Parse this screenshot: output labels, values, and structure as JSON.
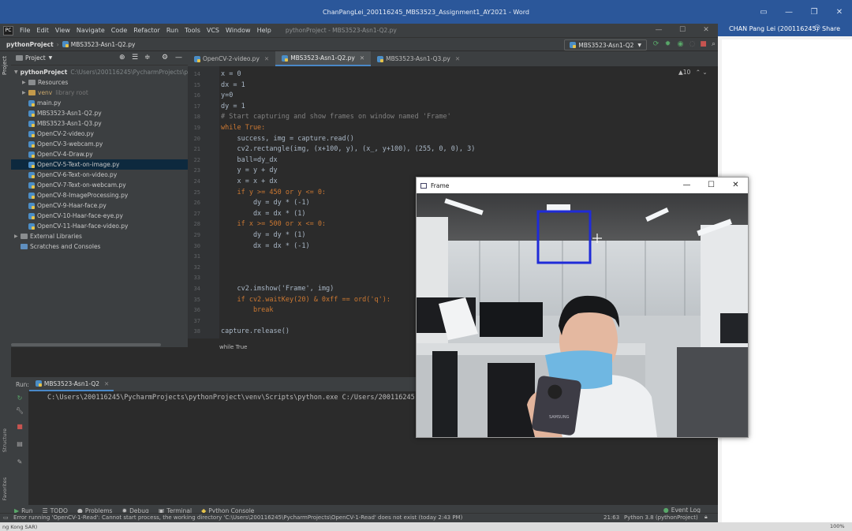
{
  "word": {
    "title": "ChanPangLei_200116245_MBS3523_Assignment1_AY2021 - Word",
    "user": "CHAN Pang Lei (200116245)",
    "share": "Share",
    "status_left": "ng Kong SAR)",
    "zoom": "100%"
  },
  "menu": {
    "items": [
      "File",
      "Edit",
      "View",
      "Navigate",
      "Code",
      "Refactor",
      "Run",
      "Tools",
      "VCS",
      "Window",
      "Help"
    ],
    "title": "pythonProject - MBS3523-Asn1-Q2.py"
  },
  "navbar": {
    "project": "pythonProject",
    "file": "MBS3523-Asn1-Q2.py",
    "run_config": "MBS3523-Asn1-Q2"
  },
  "project_panel": {
    "header": "Project",
    "root_name": "pythonProject",
    "root_path": "C:\\Users\\200116245\\PycharmProjects\\py",
    "items": [
      {
        "label": "Resources",
        "kind": "folder"
      },
      {
        "label": "venv",
        "hint": "library root",
        "kind": "venv"
      },
      {
        "label": "main.py",
        "kind": "py"
      },
      {
        "label": "MBS3523-Asn1-Q2.py",
        "kind": "py"
      },
      {
        "label": "MBS3523-Asn1-Q3.py",
        "kind": "py"
      },
      {
        "label": "OpenCV-2-video.py",
        "kind": "py"
      },
      {
        "label": "OpenCV-3-webcam.py",
        "kind": "py"
      },
      {
        "label": "OpenCV-4-Draw.py",
        "kind": "py"
      },
      {
        "label": "OpenCV-5-Text-on-image.py",
        "kind": "py"
      },
      {
        "label": "OpenCV-6-Text-on-video.py",
        "kind": "py"
      },
      {
        "label": "OpenCV-7-Text-on-webcam.py",
        "kind": "py"
      },
      {
        "label": "OpenCV-8-ImageProcessing.py",
        "kind": "py"
      },
      {
        "label": "OpenCV-9-Haar-face.py",
        "kind": "py"
      },
      {
        "label": "OpenCV-10-Haar-face-eye.py",
        "kind": "py"
      },
      {
        "label": "OpenCV-11-Haar-face-video.py",
        "kind": "py"
      },
      {
        "label": "External Libraries",
        "kind": "lib"
      },
      {
        "label": "Scratches and Consoles",
        "kind": "scratch"
      }
    ]
  },
  "tabs": [
    "OpenCV-2-video.py",
    "MBS3523-Asn1-Q2.py",
    "MBS3523-Asn1-Q3.py"
  ],
  "warnings": "▲10",
  "editor": {
    "line_numbers": [
      "14",
      "15",
      "16",
      "17",
      "18",
      "19",
      "20",
      "21",
      "22",
      "23",
      "24",
      "25",
      "26",
      "27",
      "28",
      "29",
      "30",
      "31",
      "32",
      "33",
      "34",
      "35",
      "36",
      "37",
      "38"
    ],
    "lines": [
      "x = 0",
      "dx = 1",
      "y=0",
      "dy = 1",
      "# Start capturing and show frames on window named 'Frame'",
      "while True:",
      "    success, img = capture.read()",
      "    cv2.rectangle(img, (x+100, y), (x_, y+100), (255, 0, 0), 3)",
      "    ball=dy_dx",
      "    y = y + dy",
      "    x = x + dx",
      "    if y >= 450 or y <= 0:",
      "        dy = dy * (-1)",
      "        dx = dx * (1)",
      "    if x >= 500 or x <= 0:",
      "        dy = dy * (1)",
      "        dx = dx * (-1)",
      "",
      "",
      "",
      "    cv2.imshow('Frame', img)",
      "    if cv2.waitKey(20) & 0xff == ord('q'):",
      "        break",
      "",
      "capture.release()"
    ],
    "breadcrumb": "while True"
  },
  "run_panel": {
    "label": "Run:",
    "tab": "MBS3523-Asn1-Q2",
    "console": "C:\\Users\\200116245\\PycharmProjects\\pythonProject\\venv\\Scripts\\python.exe C:/Users/200116245"
  },
  "bottom_tools": [
    "Run",
    "TODO",
    "Problems",
    "Debug",
    "Terminal",
    "Python Console"
  ],
  "event_log": "Event Log",
  "side_labels": {
    "structure": "Structure",
    "favorites": "Favorites",
    "project": "Project"
  },
  "status": {
    "message": "Error running 'OpenCV-1-Read': Cannot start process, the working directory 'C:\\Users\\200116245\\PycharmProjects\\OpenCV-1-Read' does not exist (today 2:43 PM)",
    "position": "21:63",
    "interpreter": "Python 3.8 (pythonProject)"
  },
  "frame_window": {
    "title": "Frame",
    "rect_color": "#1f2bd8",
    "phone_brand": "SAMSUNG"
  },
  "colors": {
    "accent": "#4a88c7",
    "word_blue": "#2b579a"
  }
}
